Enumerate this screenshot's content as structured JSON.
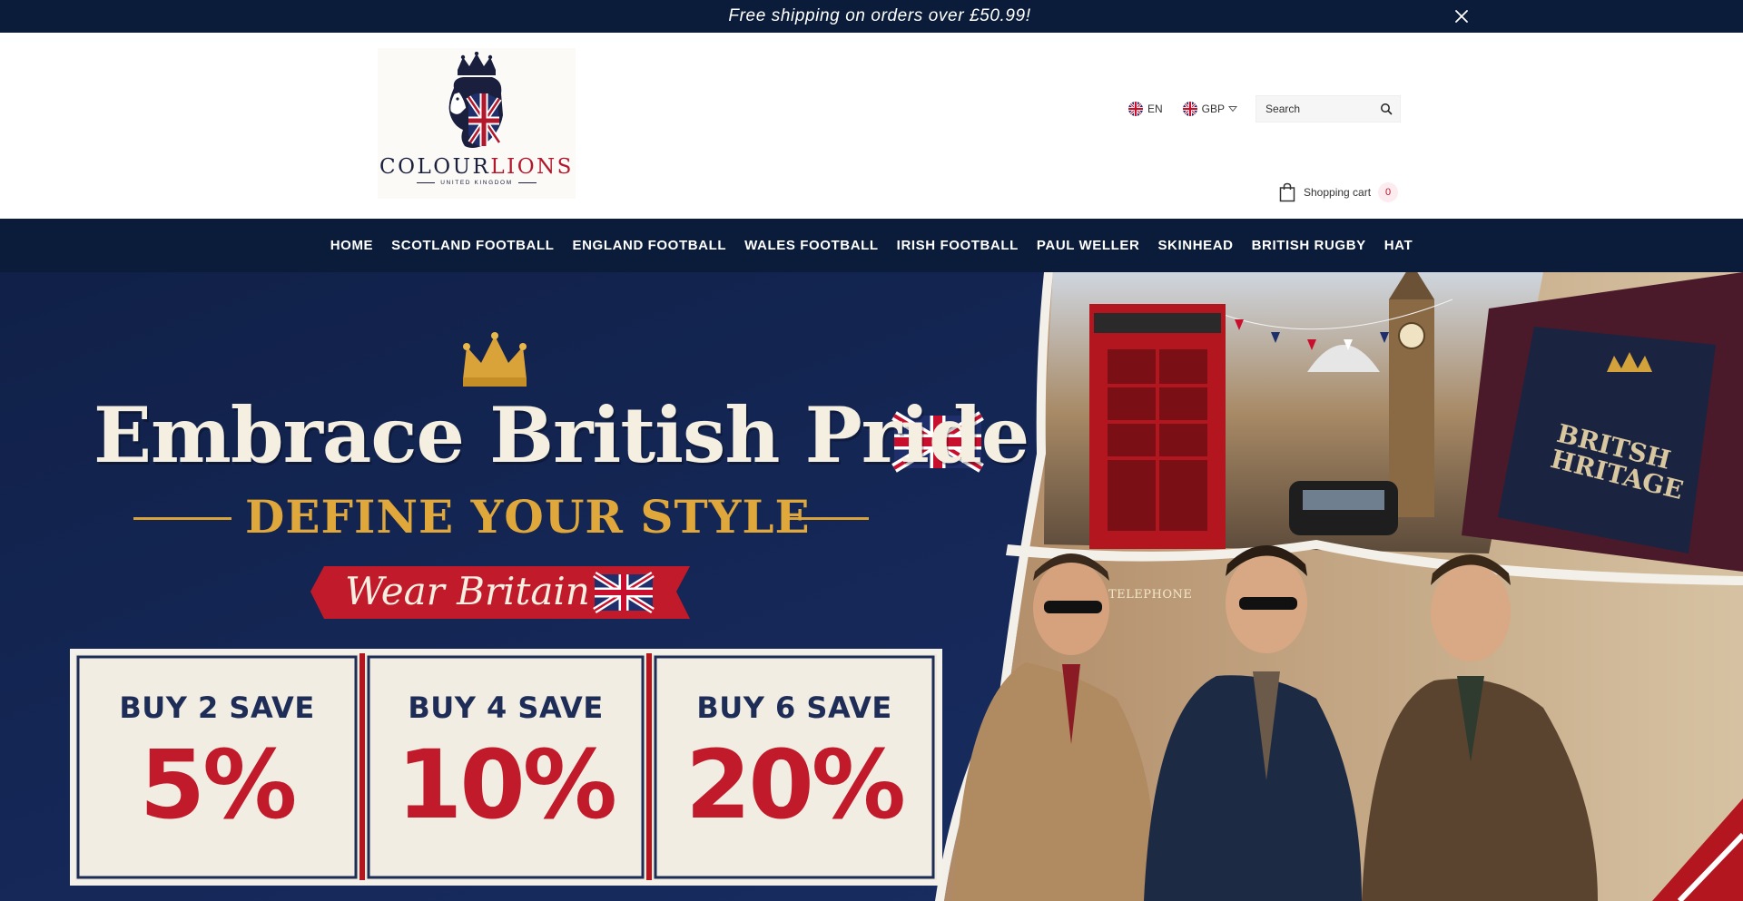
{
  "announcement": {
    "truck_icon": "",
    "text": "Free shipping on orders over £50.99!",
    "close_icon": "close-icon"
  },
  "header": {
    "logo": {
      "brand_first": "COLOUR",
      "brand_second": "LIONS",
      "subtitle": "UNITED KINGDOM"
    },
    "language": {
      "code": "EN",
      "flag": "uk-flag-icon"
    },
    "currency": {
      "code": "GBP",
      "flag": "uk-flag-icon"
    },
    "search": {
      "placeholder": "Search",
      "icon": "search-icon"
    },
    "cart": {
      "label": "Shopping cart",
      "count": "0",
      "icon": "shopping-bag-icon"
    }
  },
  "nav": {
    "items": [
      {
        "label": "HOME"
      },
      {
        "label": "SCOTLAND FOOTBALL"
      },
      {
        "label": "ENGLAND FOOTBALL"
      },
      {
        "label": "WALES FOOTBALL"
      },
      {
        "label": "IRISH FOOTBALL"
      },
      {
        "label": "PAUL WELLER"
      },
      {
        "label": "SKINHEAD"
      },
      {
        "label": "BRITISH RUGBY"
      },
      {
        "label": "HAT"
      }
    ]
  },
  "hero": {
    "headline": "Embrace British Pride",
    "subheadline": "DEFINE YOUR STYLE",
    "ribbon": "Wear Britain",
    "booth_sign": "TELEPHONE",
    "book_label_line1": "BRITSH",
    "book_label_line2": "HRITAGE",
    "deals": [
      {
        "title": "BUY 2 SAVE",
        "percent": "5%"
      },
      {
        "title": "BUY 4 SAVE",
        "percent": "10%"
      },
      {
        "title": "BUY 6 SAVE",
        "percent": "20%"
      }
    ]
  },
  "colors": {
    "navy": "#0b1c3a",
    "brand_red": "#b3172b",
    "gold": "#e0a83a",
    "cream": "#f5efe2"
  }
}
